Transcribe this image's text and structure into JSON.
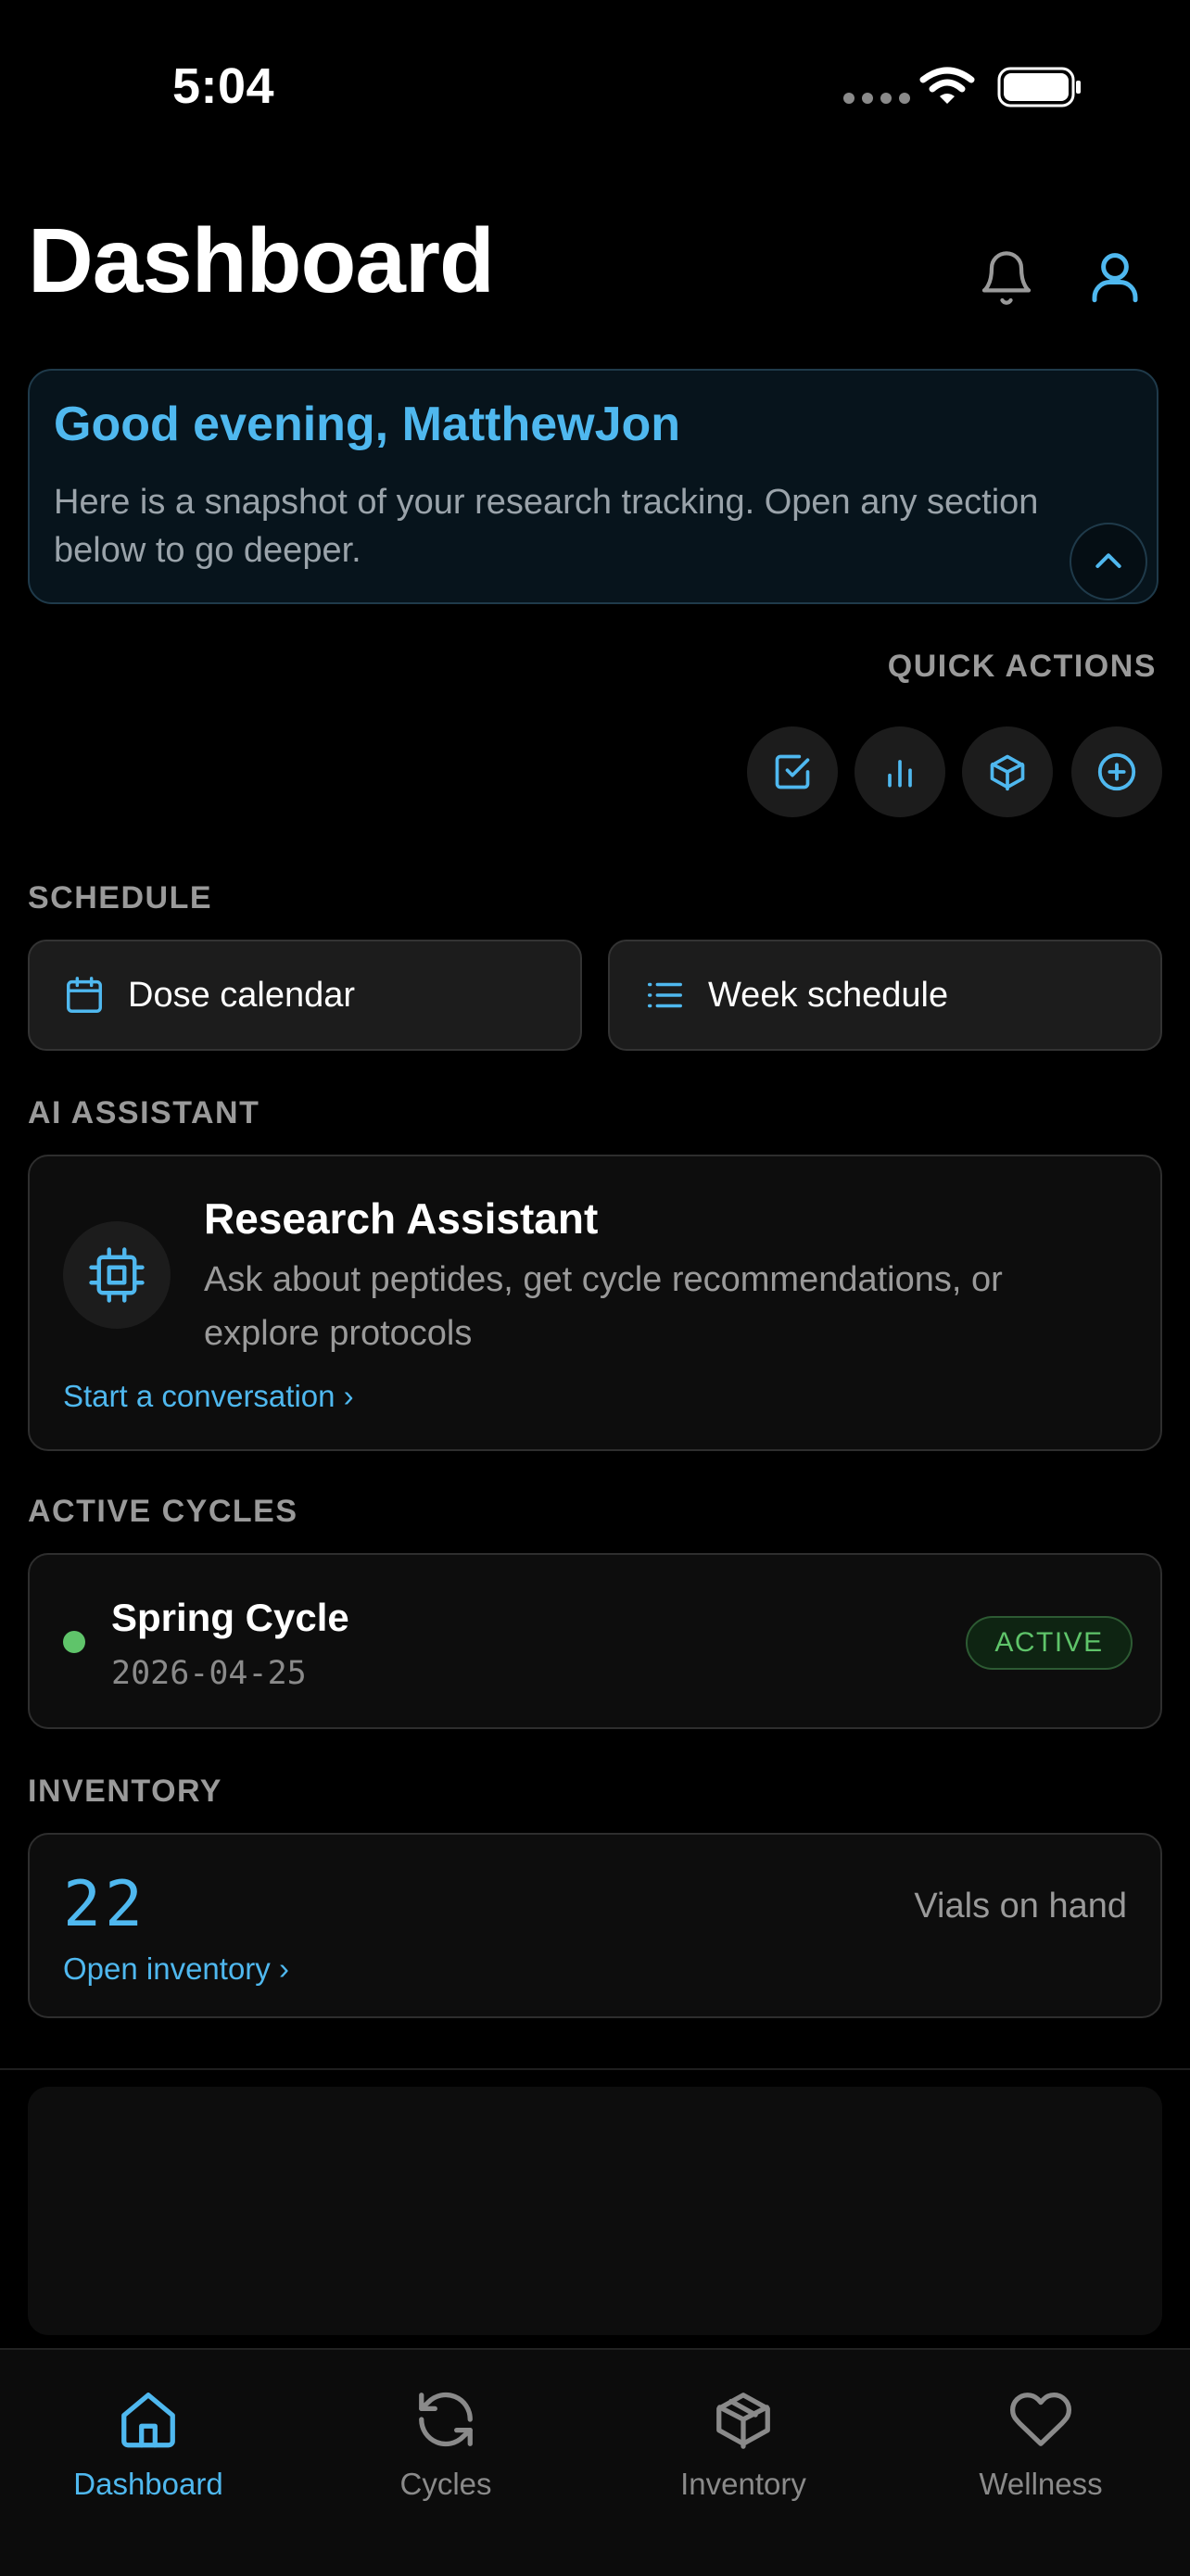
{
  "status_bar": {
    "time": "5:04"
  },
  "header": {
    "title": "Dashboard"
  },
  "greeting": {
    "title": "Good evening, MatthewJon",
    "body": "Here is a snapshot of your research tracking. Open any section below to go deeper."
  },
  "quick_actions": {
    "label": "QUICK ACTIONS",
    "icons": [
      "checkbox-icon",
      "bar-chart-icon",
      "box-icon",
      "plus-circle-icon"
    ]
  },
  "schedule": {
    "label": "SCHEDULE",
    "dose_calendar": "Dose calendar",
    "week_schedule": "Week schedule"
  },
  "ai_assistant": {
    "label": "AI ASSISTANT",
    "title": "Research Assistant",
    "description": "Ask about peptides, get cycle recommendations, or explore protocols",
    "link": "Start a conversation ›"
  },
  "active_cycles": {
    "label": "ACTIVE CYCLES",
    "items": [
      {
        "name": "Spring Cycle",
        "date": "2026-04-25",
        "status": "ACTIVE"
      }
    ]
  },
  "inventory": {
    "label": "INVENTORY",
    "count": "22",
    "count_label": "Vials on hand",
    "link": "Open inventory ›"
  },
  "tabs": [
    {
      "label": "Dashboard",
      "active": true
    },
    {
      "label": "Cycles",
      "active": false
    },
    {
      "label": "Inventory",
      "active": false
    },
    {
      "label": "Wellness",
      "active": false
    }
  ],
  "colors": {
    "accent": "#4fb8ef",
    "active_green": "#5fc46a",
    "background": "#000000"
  }
}
